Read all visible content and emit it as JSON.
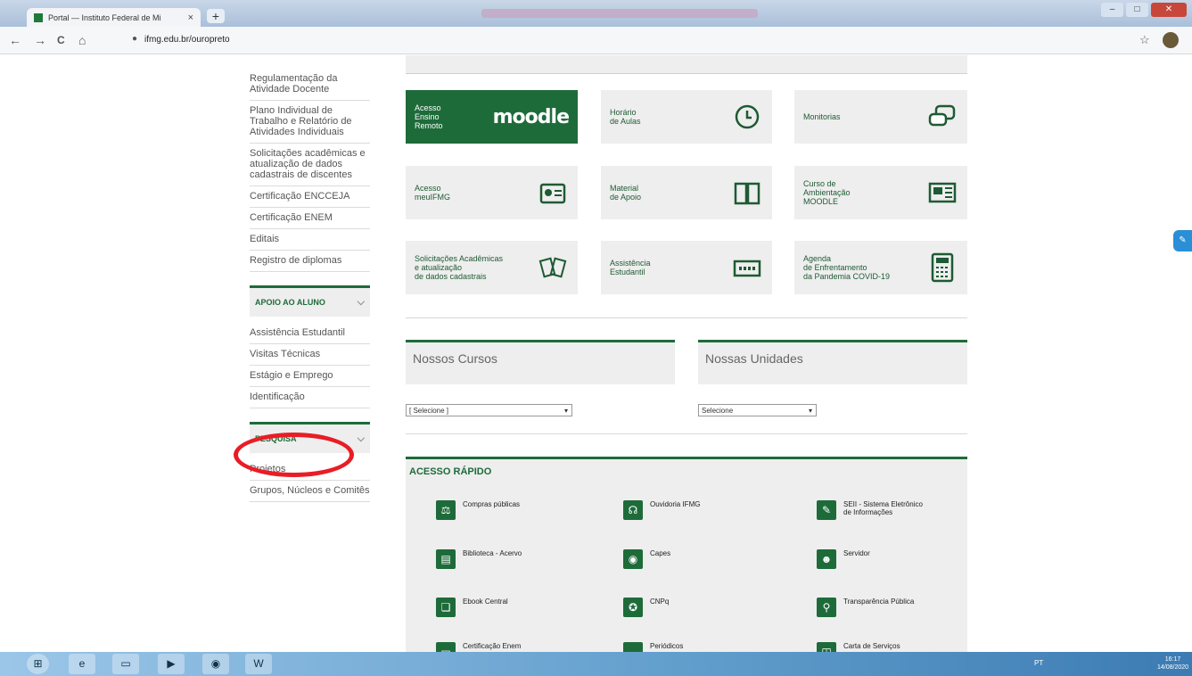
{
  "browser": {
    "tab_title": "Portal — Instituto Federal de Mi",
    "tab_close": "×",
    "new_tab": "+",
    "url": "ifmg.edu.br/ouropreto",
    "nav": {
      "back": "←",
      "forward": "→",
      "reload": "C",
      "home": "⌂",
      "lock": "🔒",
      "star": "☆"
    }
  },
  "sidebar": {
    "links_top": [
      "Regulamentação da Atividade Docente",
      "Plano Individual de Trabalho e Relatório de Atividades Individuais",
      "Solicitações acadêmicas e atualização de dados cadastrais de discentes",
      "Certificação ENCCEJA",
      "Certificação ENEM",
      "Editais",
      "Registro de diplomas"
    ],
    "apoio": {
      "heading": "APOIO AO ALUNO",
      "chevron": "⌵",
      "links": [
        "Assistência Estudantil",
        "Visitas Técnicas",
        "Estágio e Emprego",
        "Identificação"
      ]
    },
    "pesquisa": {
      "heading": "PESQUISA",
      "chevron": "⌵",
      "links": [
        "Projetos",
        "Grupos, Núcleos e Comitês"
      ]
    }
  },
  "cards": [
    {
      "label": "Acesso\nEnsino\nRemoto",
      "extra": "moodle",
      "icon": "moodle-logo"
    },
    {
      "label": "Horário\nde Aulas",
      "icon": "clock-icon"
    },
    {
      "label": "Monitorias",
      "icon": "chat-bubbles-icon"
    },
    {
      "label": "Acesso\nmeuIFMG",
      "icon": "id-badge-icon"
    },
    {
      "label": "Material\nde Apoio",
      "icon": "open-book-icon"
    },
    {
      "label": "Curso de\nAmbientação\nMOODLE",
      "icon": "presentation-board-icon"
    },
    {
      "label": "Solicitações Acadêmicas\ne atualização\nde dados cadastrais",
      "icon": "documents-icon"
    },
    {
      "label": "Assistência\nEstudantil",
      "icon": "calculator-display-icon"
    },
    {
      "label": "Agenda\nde Enfrentamento\nda Pandemia COVID-19",
      "icon": "calculator-icon"
    }
  ],
  "cursos": {
    "title": "Nossos Cursos",
    "select_value": "[ Selecione ]"
  },
  "unidades": {
    "title": "Nossas Unidades",
    "select_value": "Selecione"
  },
  "select_arrow": "▾",
  "quick_access": {
    "title": "ACESSO RÁPIDO",
    "items": [
      {
        "label": "Compras públicas",
        "icon": "gavel-icon",
        "glyph": "⚖"
      },
      {
        "label": "Ouvidoria IFMG",
        "icon": "headset-icon",
        "glyph": "☊"
      },
      {
        "label": "SEII - Sistema Eletrônico\nde Informações",
        "icon": "document-edit-icon",
        "glyph": "✎"
      },
      {
        "label": "Biblioteca - Acervo",
        "icon": "books-icon",
        "glyph": "▤"
      },
      {
        "label": "Capes",
        "icon": "eye-icon",
        "glyph": "◉"
      },
      {
        "label": "Servidor",
        "icon": "user-icon",
        "glyph": "☻"
      },
      {
        "label": "Ebook Central",
        "icon": "book-icon",
        "glyph": "❏"
      },
      {
        "label": "CNPq",
        "icon": "cnpq-icon",
        "glyph": "✪"
      },
      {
        "label": "Transparência Pública",
        "icon": "magnifier-icon",
        "glyph": "⚲"
      },
      {
        "label": "Certificação Enem",
        "icon": "certificate-icon",
        "glyph": "▭"
      },
      {
        "label": "Periódicos",
        "icon": "newspaper-icon",
        "glyph": "▬"
      },
      {
        "label": "Carta de Serviços",
        "icon": "open-book-icon",
        "glyph": "◫"
      }
    ]
  },
  "taskbar": {
    "start": "⊞",
    "apps": [
      "e",
      "▭",
      "▶",
      "◉",
      "W"
    ],
    "tray": "PT",
    "time": "16:17",
    "date": "14/08/2020"
  },
  "side_widget": "✎",
  "colors": {
    "brand_green": "#1e6b3a",
    "annotation_red": "#e81d25"
  }
}
